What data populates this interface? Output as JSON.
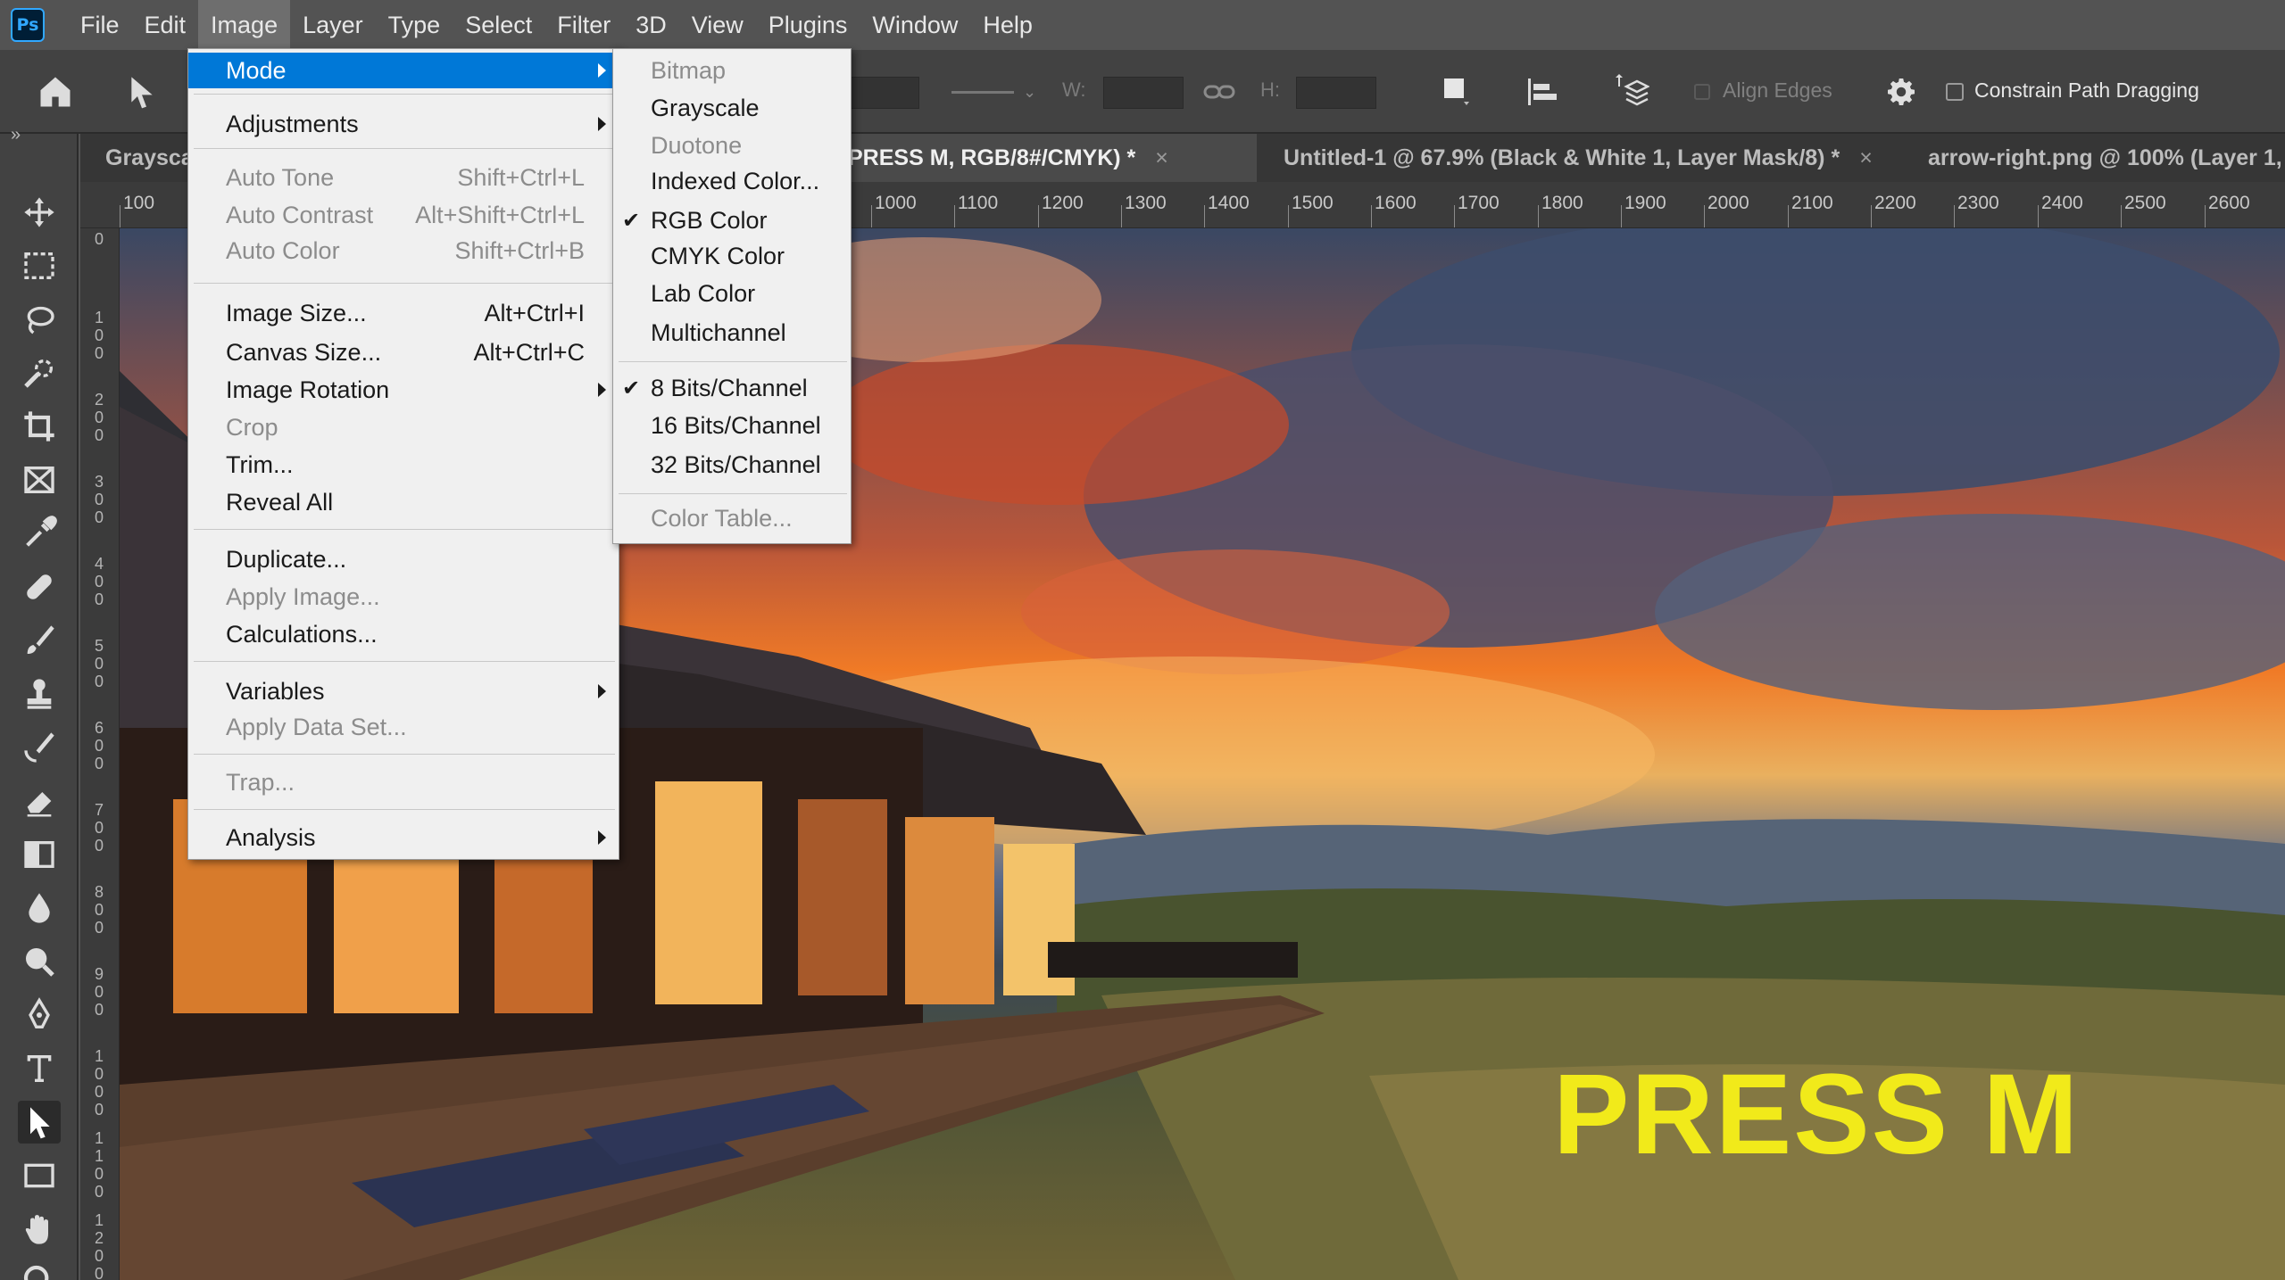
{
  "app": {
    "logo": "Ps"
  },
  "menubar": {
    "items": [
      "File",
      "Edit",
      "Image",
      "Layer",
      "Type",
      "Select",
      "Filter",
      "3D",
      "View",
      "Plugins",
      "Window",
      "Help"
    ],
    "active": "Image"
  },
  "options_bar": {
    "w_label": "W:",
    "h_label": "H:",
    "align_edges": "Align Edges",
    "constrain_path": "Constrain Path Dragging",
    "panel_toggle": "»"
  },
  "tabs": [
    {
      "label": "Graysca",
      "active": false
    },
    {
      "label": "PRESS M, RGB/8#/CMYK) *",
      "active": true
    },
    {
      "label": "Untitled-1 @ 67.9% (Black & White 1, Layer Mask/8) *",
      "active": false
    },
    {
      "label": "arrow-right.png @ 100% (Layer 1, RGB/8",
      "active": false
    }
  ],
  "tab_close": "×",
  "ruler_h": [
    "100",
    "1000",
    "1100",
    "1200",
    "1300",
    "1400",
    "1500",
    "1600",
    "1700",
    "1800",
    "1900",
    "2000",
    "2100",
    "2200",
    "2300",
    "2400",
    "2500",
    "2600"
  ],
  "ruler_v": [
    "0",
    "100",
    "200",
    "300",
    "400",
    "500",
    "600",
    "700",
    "800",
    "900",
    "1000",
    "1100",
    "1200"
  ],
  "image_menu": {
    "mode": "Mode",
    "adjustments": "Adjustments",
    "auto_tone": "Auto Tone",
    "auto_tone_sc": "Shift+Ctrl+L",
    "auto_contrast": "Auto Contrast",
    "auto_contrast_sc": "Alt+Shift+Ctrl+L",
    "auto_color": "Auto Color",
    "auto_color_sc": "Shift+Ctrl+B",
    "image_size": "Image Size...",
    "image_size_sc": "Alt+Ctrl+I",
    "canvas_size": "Canvas Size...",
    "canvas_size_sc": "Alt+Ctrl+C",
    "image_rotation": "Image Rotation",
    "crop": "Crop",
    "trim": "Trim...",
    "reveal_all": "Reveal All",
    "duplicate": "Duplicate...",
    "apply_image": "Apply Image...",
    "calculations": "Calculations...",
    "variables": "Variables",
    "apply_data_set": "Apply Data Set...",
    "trap": "Trap...",
    "analysis": "Analysis"
  },
  "mode_submenu": {
    "bitmap": "Bitmap",
    "grayscale": "Grayscale",
    "duotone": "Duotone",
    "indexed": "Indexed Color...",
    "rgb": "RGB Color",
    "cmyk": "CMYK Color",
    "lab": "Lab Color",
    "multichannel": "Multichannel",
    "bits8": "8 Bits/Channel",
    "bits16": "16 Bits/Channel",
    "bits32": "32 Bits/Channel",
    "color_table": "Color Table...",
    "check": "✔"
  },
  "canvas": {
    "overlay_text": "PRESS M"
  }
}
